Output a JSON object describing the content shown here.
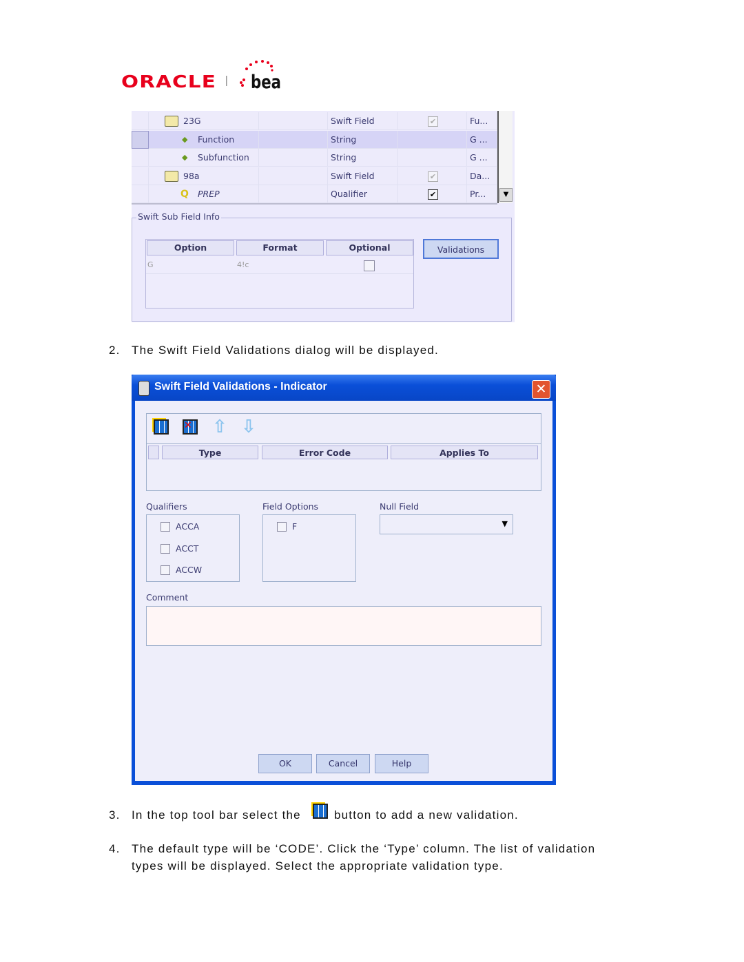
{
  "logo": {
    "oracle": "ORACLE",
    "bea": "bea",
    "oracle_color": "#e8001c"
  },
  "tree_table": {
    "rows": [
      {
        "name": "23G",
        "type": "Swift Field",
        "checked": true,
        "disabled": true,
        "desc": "Fu...",
        "icon": "folder-icon",
        "level": 0
      },
      {
        "name": "Function",
        "type": "String",
        "checked": null,
        "desc": "G ...",
        "icon": "diamond-icon",
        "level": 1,
        "selected": true
      },
      {
        "name": "Subfunction",
        "type": "String",
        "checked": null,
        "desc": "G ...",
        "icon": "optional-diamond-icon",
        "level": 1
      },
      {
        "name": "98a",
        "type": "Swift Field",
        "checked": true,
        "disabled": true,
        "desc": "Da...",
        "icon": "folder-icon",
        "level": 0
      },
      {
        "name": "PREP",
        "type": "Qualifier",
        "checked": true,
        "desc": "Pr...",
        "icon": "qualifier-icon",
        "level": 1
      }
    ]
  },
  "sub_field_info": {
    "legend": "Swift Sub Field Info",
    "columns": [
      "Option",
      "Format",
      "Optional"
    ],
    "rows": [
      {
        "option": "G",
        "format": "4!c",
        "optional": false
      }
    ],
    "validations_button": "Validations"
  },
  "step2": {
    "num": "2.",
    "text": "The Swift Field Validations dialog will be displayed."
  },
  "dialog": {
    "title": "Swift Field Validations - Indicator",
    "toolbar": [
      "add-row-icon",
      "delete-row-icon",
      "move-up-icon",
      "move-down-icon"
    ],
    "columns": [
      "Type",
      "Error Code",
      "Applies To"
    ],
    "qualifiers_label": "Qualifiers",
    "qualifiers": [
      "ACCA",
      "ACCT",
      "ACCW"
    ],
    "field_options_label": "Field Options",
    "field_options": [
      "F"
    ],
    "null_field_label": "Null Field",
    "null_field_value": "",
    "comment_label": "Comment",
    "comment_value": "",
    "ok": "OK",
    "cancel": "Cancel",
    "help": "Help",
    "title_color": "#0a4fd8"
  },
  "step3": {
    "num": "3.",
    "before": "In the top tool bar select the",
    "after": "button to add a new validation."
  },
  "step4": {
    "num": "4.",
    "line1": "The default type will be ‘CODE’. Click the ‘Type’ column. The list of validation",
    "line2": "types will be displayed. Select the appropriate validation type."
  }
}
